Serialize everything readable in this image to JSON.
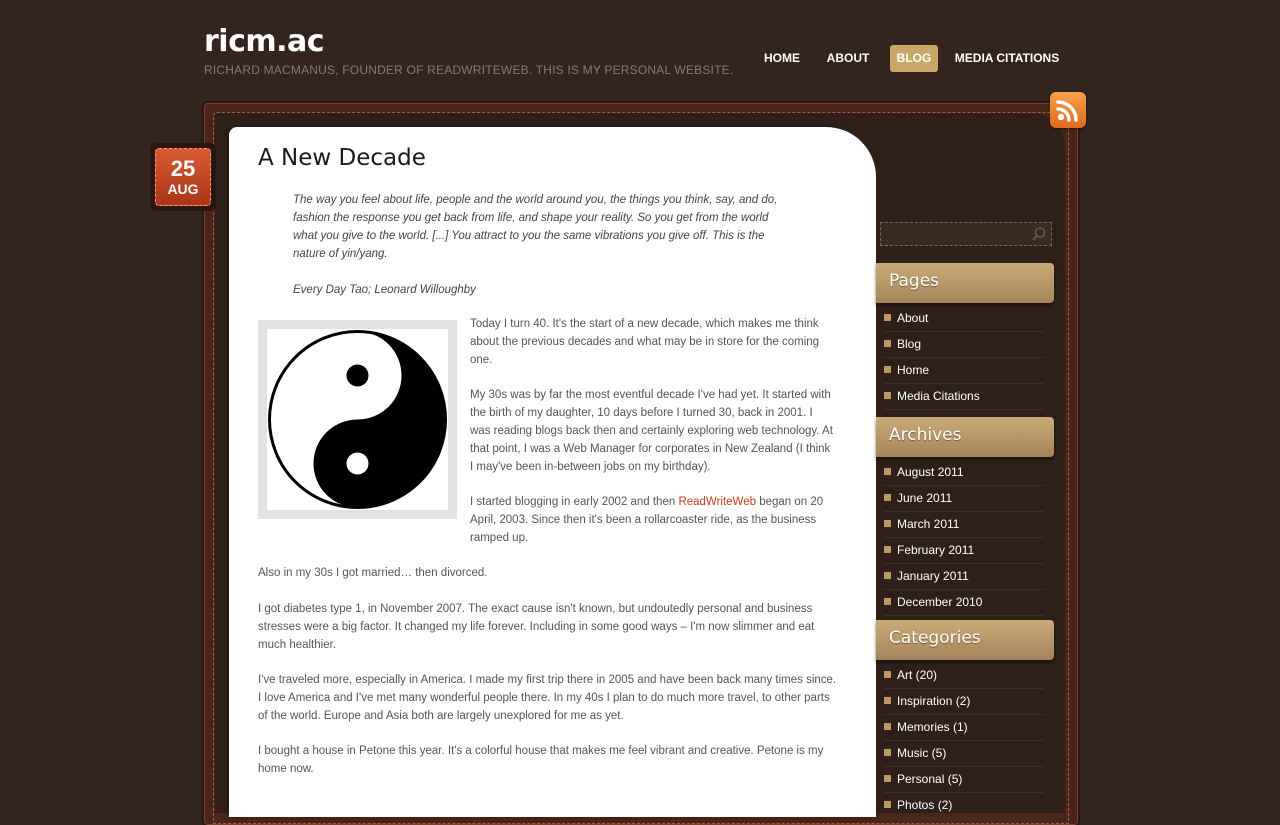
{
  "site": {
    "title": "ricm.ac",
    "tagline": "RICHARD MACMANUS, FOUNDER OF READWRITEWEB. THIS IS MY PERSONAL WEBSITE."
  },
  "nav": {
    "items": [
      {
        "label": "HOME",
        "active": false
      },
      {
        "label": "ABOUT",
        "active": false
      },
      {
        "label": "BLOG",
        "active": true
      },
      {
        "label": "MEDIA CITATIONS",
        "active": false
      }
    ]
  },
  "colors": {
    "background": "#33241d",
    "accent": "#c8a869",
    "link": "#c0401e",
    "date_badge": "#c0461f"
  },
  "post": {
    "date_day": "25",
    "date_month": "AUG",
    "title": "A New Decade",
    "quote": "The way you feel about life, people and the world around you, the things you think, say, and do, fashion the response you get back from life, and shape your reality. So you get from the world what you give to the world. [...] You attract to you the same vibrations you give off. This is the nature of yin/yang.",
    "quote_source": "Every Day Tao; Leonard Willoughby",
    "image_icon": "yin-yang-icon",
    "p1": "Today I turn 40. It's the start of a new decade, which makes me think about the previous decades and what may be in store for the coming one.",
    "p2": "My 30s was by far the most eventful decade I've had yet. It started with the birth of my daughter, 10 days before I turned 30, back in 2001. I was reading blogs back then and certainly exploring web technology. At that point, I was a Web Manager for corporates in New Zealand (I think I may've been in-between jobs on my birthday).",
    "p3_before": "I started blogging in early 2002 and then ",
    "p3_link": "ReadWriteWeb",
    "p3_after": " began on 20 April, 2003. Since then it's been a rollarcoaster ride, as the business ramped up.",
    "p4": "Also in my 30s I got married… then divorced.",
    "p5": "I got diabetes type 1, in November 2007. The exact cause isn't known, but undoutedly personal and business stresses were a big factor. It changed my life forever. Including in some good ways – I'm now slimmer and eat much healthier.",
    "p6": "I've traveled more, especially in America. I made my first trip there in 2005 and have been back many times since. I love America and I've met many wonderful people there. In my 40s I plan to do much more travel, to other parts of the world. Europe and Asia both are largely unexplored for me as yet.",
    "p7": "I bought a house in Petone this year. It's a colorful house that makes me feel vibrant and creative. Petone is my home now."
  },
  "sidebar": {
    "search_icon": "search-icon",
    "rss_icon": "rss-icon",
    "pages": {
      "heading": "Pages",
      "items": [
        "About",
        "Blog",
        "Home",
        "Media Citations"
      ]
    },
    "archives": {
      "heading": "Archives",
      "items": [
        "August 2011",
        "June 2011",
        "March 2011",
        "February 2011",
        "January 2011",
        "December 2010"
      ]
    },
    "categories": {
      "heading": "Categories",
      "items": [
        "Art (20)",
        "Inspiration (2)",
        "Memories (1)",
        "Music (5)",
        "Personal (5)",
        "Photos (2)"
      ]
    }
  }
}
